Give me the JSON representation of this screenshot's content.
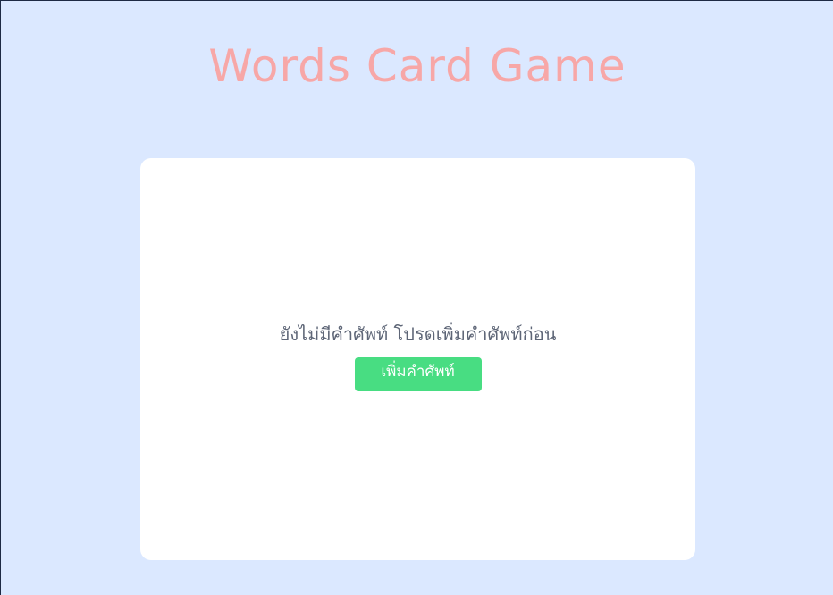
{
  "header": {
    "title": "Words Card Game"
  },
  "card": {
    "empty_message": "ยังไม่มีคำศัพท์ โปรดเพิ่มคำศัพท์ก่อน",
    "add_button_label": "เพิ่มคำศัพท์"
  },
  "colors": {
    "background": "#dbe8ff",
    "title": "#f7a7a7",
    "card": "#ffffff",
    "button": "#48dd82",
    "message_text": "#5e6677"
  }
}
